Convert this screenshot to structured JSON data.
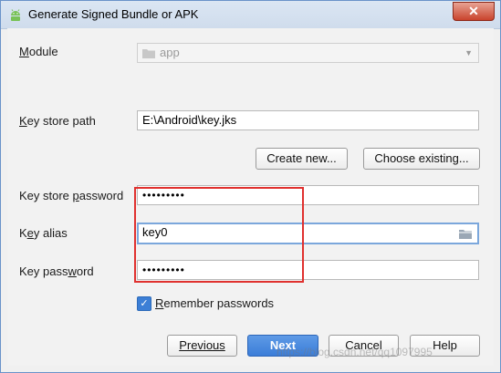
{
  "window": {
    "title": "Generate Signed Bundle or APK",
    "close_label": "✕"
  },
  "module": {
    "label_mnemonic": "M",
    "label_rest": "odule",
    "value": "app"
  },
  "key_store_path": {
    "label_mnemonic": "K",
    "label_rest": "ey store path",
    "value": "E:\\Android\\key.jks"
  },
  "buttons": {
    "create_new": "Create new...",
    "choose_existing": "Choose existing..."
  },
  "key_store_password": {
    "label_pre": "Key store ",
    "label_mnemonic": "p",
    "label_post": "assword",
    "value": "•••••••••"
  },
  "key_alias": {
    "label_pre": "K",
    "label_mnemonic": "e",
    "label_post": "y alias",
    "value": "key0"
  },
  "key_password": {
    "label_pre": "Key pass",
    "label_mnemonic": "w",
    "label_post": "ord",
    "value": "•••••••••"
  },
  "remember": {
    "label_mnemonic": "R",
    "label_rest": "emember passwords",
    "checked": true
  },
  "footer": {
    "previous": "Previous",
    "next": "Next",
    "cancel": "Cancel",
    "help": "Help"
  },
  "watermark": "https://blog.csdn.net/qq1097995"
}
